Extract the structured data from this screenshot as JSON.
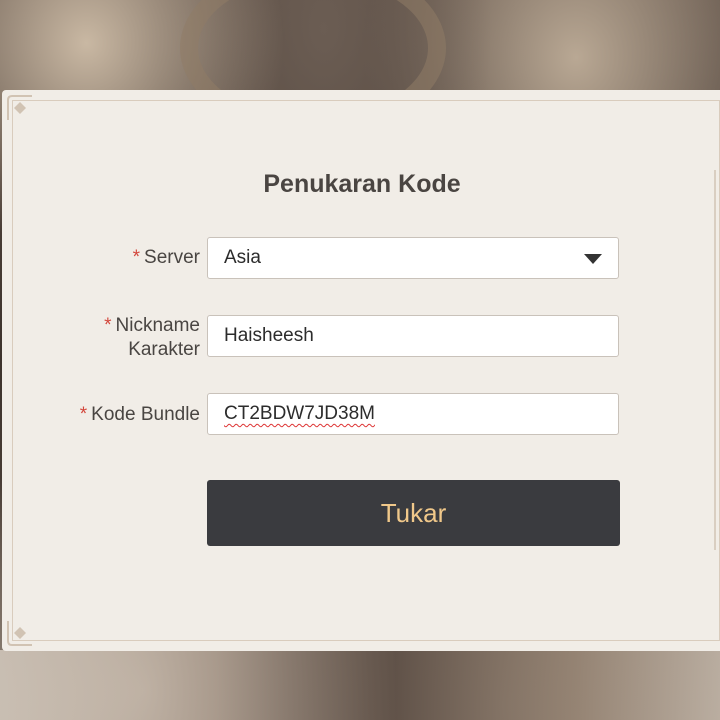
{
  "form": {
    "title": "Penukaran Kode",
    "required_mark": "*",
    "server": {
      "label": "Server",
      "value": "Asia"
    },
    "nickname": {
      "label_line1": "Nickname",
      "label_line2": "Karakter",
      "value": "Haisheesh"
    },
    "bundle": {
      "label": "Kode Bundle",
      "value": "CT2BDW7JD38M"
    },
    "submit_label": "Tukar"
  },
  "colors": {
    "required": "#d3473c",
    "button_bg": "#3a3b3f",
    "button_text": "#f0c88a",
    "panel_bg": "#f1ede7"
  },
  "icons": {
    "server_dropdown": "chevron-down-icon"
  }
}
